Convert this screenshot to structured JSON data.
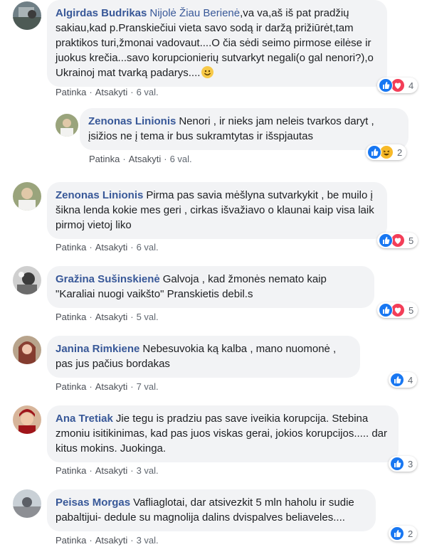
{
  "actions": {
    "like": "Patinka",
    "reply": "Atsakyti",
    "sep": "·"
  },
  "comments": [
    {
      "author": "Algirdas Budrikas",
      "mention": "Nijolė Žiau Berienė",
      "text": ",va va,aš iš pat pradžių sakiau,kad p.Pranskiečiui vieta savo sodą ir daržą prižiūrėt,tam praktikos turi,žmonai vadovaut....O čia sėdi seimo pirmose eilėse ir juokus krečia...savo korupcionierių sutvarkyt negali(o gal nenori?),o Ukrainoj mat tvarką padarys....",
      "emoji": "smiling-face",
      "time": "6 val.",
      "reactions": [
        "like",
        "love"
      ],
      "count": "4"
    },
    {
      "author": "Zenonas Linionis",
      "text": "Nenori , ir nieks jam neleis tvarkos daryt , įsižios ne į tema ir bus sukramtytas ir išspjautas",
      "time": "6 val.",
      "reactions": [
        "like",
        "haha"
      ],
      "count": "2"
    },
    {
      "author": "Zenonas Linionis",
      "text": "Pirma pas savia mėšlyna sutvarkykit , be muilo į šikna lenda kokie mes geri , cirkas išvažiavo o klaunai kaip visa laik pirmoj vietoj liko",
      "time": "6 val.",
      "reactions": [
        "like",
        "love"
      ],
      "count": "5"
    },
    {
      "author": "Gražina Sušinskienė",
      "text": "Galvoja , kad žmonės nemato kaip \"Karaliai nuogi vaikšto\" Pranskietis debil.s",
      "time": "5 val.",
      "reactions": [
        "like",
        "love"
      ],
      "count": "5"
    },
    {
      "author": "Janina Rimkiene",
      "text": "Nebesuvokia ką kalba , mano nuomonė , pas jus pačius bordakas",
      "time": "7 val.",
      "reactions": [
        "like"
      ],
      "count": "4"
    },
    {
      "author": "Ana Tretiak",
      "text": "Jie tegu is pradziu pas save iveikia korupcija. Stebina zmoniu isitikinimas, kad pas juos viskas gerai, jokios korupcijos..... dar kitus mokins. Juokinga.",
      "time": "3 val.",
      "reactions": [
        "like"
      ],
      "count": "3"
    },
    {
      "author": "Peisas Morgas",
      "text": "Vafliaglotai, dar atsivezkit 5 mln haholu ir sudie pabaltijui- dedule su magnolija dalins dvispalves beliaveles....",
      "time": "3 val.",
      "reactions": [
        "like"
      ],
      "count": "2"
    }
  ]
}
